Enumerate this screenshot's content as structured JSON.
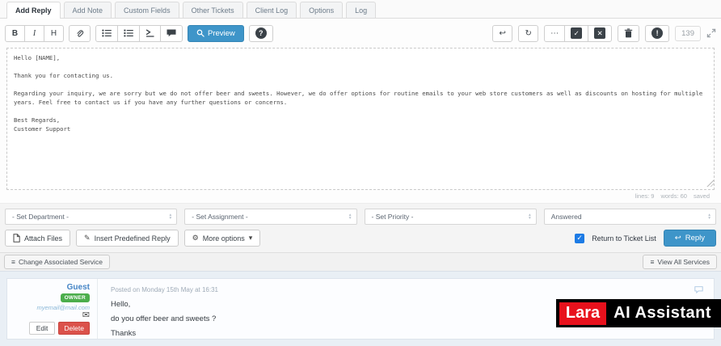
{
  "tabs": {
    "items": [
      {
        "label": "Add Reply",
        "active": true
      },
      {
        "label": "Add Note",
        "active": false
      },
      {
        "label": "Custom Fields",
        "active": false
      },
      {
        "label": "Other Tickets",
        "active": false
      },
      {
        "label": "Client Log",
        "active": false
      },
      {
        "label": "Options",
        "active": false
      },
      {
        "label": "Log",
        "active": false
      }
    ]
  },
  "toolbar": {
    "bold": "B",
    "italic": "I",
    "heading": "H",
    "preview_label": "Preview",
    "char_count": "139"
  },
  "icons": {
    "undo": "↩",
    "refresh": "↻",
    "ellipsis": "⋯",
    "check": "✓",
    "cross": "✕",
    "info": "!",
    "question": "?",
    "caret_up": "▴",
    "caret_down": "▾",
    "menu_caret": "▾",
    "envelope": "✉",
    "gear": "⚙",
    "pencil": "✎",
    "hamburger": "≡",
    "list": "≡",
    "reply_arrow": "↩",
    "checkbox_check": "✓"
  },
  "editor": {
    "content": "Hello [NAME],\n\nThank you for contacting us.\n\nRegarding your inquiry, we are sorry but we do not offer beer and sweets. However, we do offer options for routine emails to your web store customers as well as discounts on hosting for multiple years. Feel free to contact us if you have any further questions or concerns.\n\nBest Regards,\nCustomer Support",
    "status": {
      "lines": "lines: 9",
      "words": "words: 60",
      "saved": "saved"
    }
  },
  "selects": [
    {
      "value": "- Set Department -"
    },
    {
      "value": "- Set Assignment -"
    },
    {
      "value": "- Set Priority -"
    },
    {
      "value": "Answered"
    }
  ],
  "actions": {
    "attach_label": "Attach Files",
    "predefined_label": "Insert Predefined Reply",
    "more_label": "More options",
    "return_label": "Return to Ticket List",
    "reply_label": "Reply"
  },
  "services": {
    "change_label": "Change Associated Service",
    "view_all_label": "View All Services"
  },
  "message": {
    "author": "Guest",
    "badge": "OWNER",
    "email": "myemail@mail.com",
    "posted": "Posted on Monday 15th May at 16:31",
    "lines": [
      "Hello,",
      "do you offer beer and sweets ?",
      "Thanks"
    ],
    "edit_label": "Edit",
    "delete_label": "Delete"
  },
  "logo": {
    "brand": "Lara",
    "product": "AI Assistant"
  },
  "colors": {
    "accent_blue": "#3e95c9",
    "badge_green": "#4cae4c",
    "delete_red": "#db524b",
    "checkbox_blue": "#1d7be5",
    "logo_red": "#e8111c",
    "thread_bg": "#e9eff5"
  }
}
